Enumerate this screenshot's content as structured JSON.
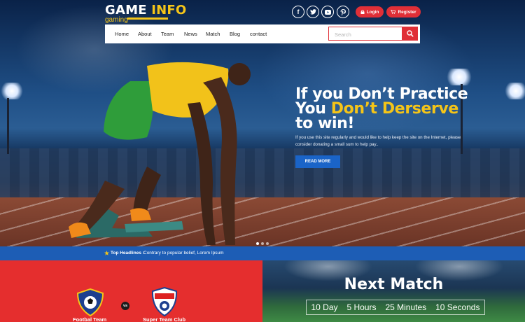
{
  "brand": {
    "title_main": "GAME",
    "title_accent": "INFO",
    "subtitle": "gaming"
  },
  "social": [
    "facebook-icon",
    "twitter-icon",
    "youtube-icon",
    "pinterest-icon"
  ],
  "auth": {
    "login_label": "Login",
    "register_label": "Register"
  },
  "nav": {
    "items": [
      "Home",
      "About",
      "Team",
      "News",
      "Match",
      "Blog",
      "contact"
    ]
  },
  "search": {
    "placeholder": "Search"
  },
  "hero": {
    "line1": "If you Don’t Practice",
    "line2_plain": "You",
    "line2_accent": "Don’t Derserve",
    "line3": "to win!",
    "description": "If you use this site regularly and would like to help keep the site on the Internet, please consider donating a small sum to help pay..",
    "button_label": "READ MORE"
  },
  "ticker": {
    "label": "Top Headlines :",
    "text": "Contrary to popular belief, Lorem Ipsum"
  },
  "match": {
    "team1": "Footbal Team",
    "vs": "vs",
    "team2": "Super Team Club",
    "title": "Next Match",
    "countdown": [
      "10 Day",
      "5 Hours",
      "25 Minutes",
      "10 Seconds"
    ]
  },
  "colors": {
    "accent_yellow": "#f5c518",
    "brand_red": "#e02f37",
    "brand_blue": "#1a64c8"
  }
}
